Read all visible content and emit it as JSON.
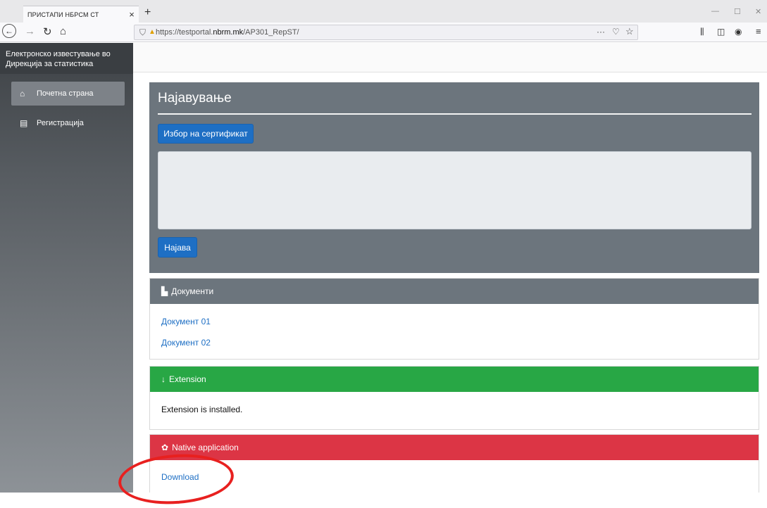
{
  "browser": {
    "tab_title": "ПРИСТАПИ НБРСМ СТ",
    "tab_close": "×",
    "new_tab": "+",
    "url_prefix": "https://testportal.",
    "url_domain": "nbrm.mk",
    "url_path": "/AP301_RepST/",
    "url_menu": "···",
    "icons": [
      "back-icon",
      "forward-icon",
      "reload-icon",
      "home-icon",
      "shield-icon",
      "lock-warning-icon",
      "pocket-icon",
      "bookmark-star-icon",
      "library-icon",
      "sidebar-icon",
      "account-icon",
      "menu-icon"
    ]
  },
  "sidebar": {
    "title": "Електронско известување во Дирекција за статистика",
    "items": [
      {
        "label": "Почетна страна",
        "icon": "home-icon"
      },
      {
        "label": "Регистрација",
        "icon": "table-icon"
      }
    ]
  },
  "login": {
    "title": "Најавување",
    "cert_button": "Избор на сертификат",
    "certificate_text": "",
    "login_button": "Најава"
  },
  "documents": {
    "header": "Документи",
    "icon": "book-icon",
    "links": [
      "Документ 01",
      "Документ 02"
    ]
  },
  "extension": {
    "header": "Extension",
    "icon": "arrow-down-icon",
    "status": "Extension is installed."
  },
  "native": {
    "header": "Native application",
    "icon": "spinner-icon",
    "download": "Download"
  },
  "colors": {
    "panel_gray": "#6c757d",
    "primary": "#1e6fc4",
    "success": "#28a745",
    "danger": "#dc3545",
    "annotation": "#e8201f"
  }
}
